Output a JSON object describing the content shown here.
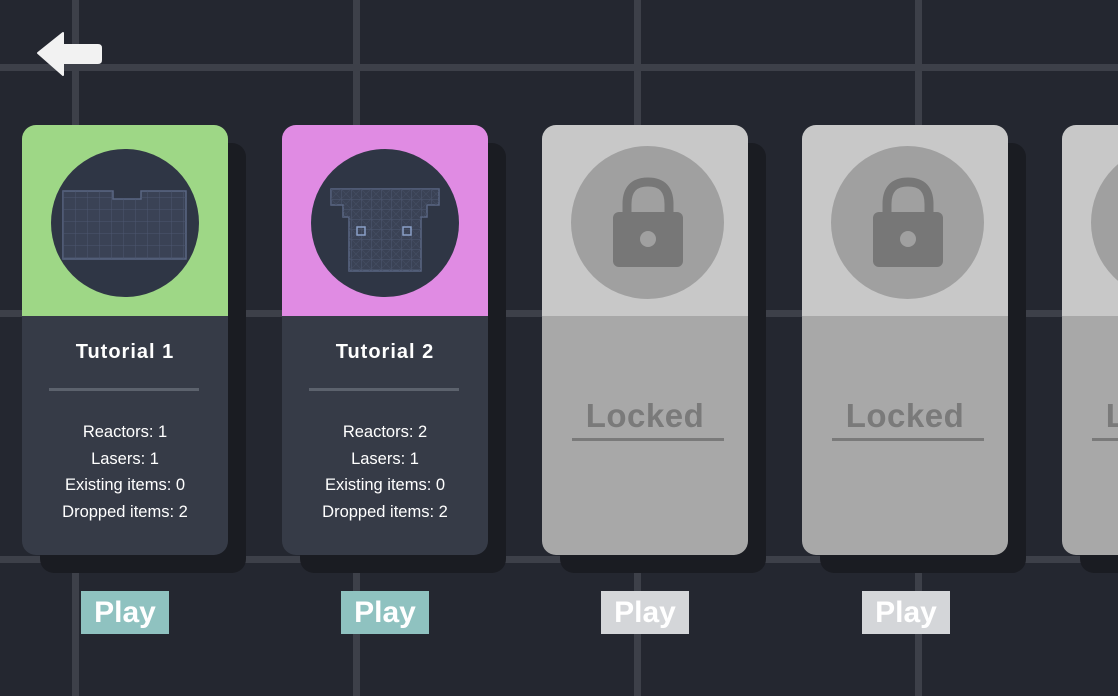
{
  "levels": [
    {
      "title": "Tutorial 1",
      "stats": {
        "reactors": "Reactors: 1",
        "lasers": "Lasers: 1",
        "existing": "Existing items: 0",
        "dropped": "Dropped items: 2"
      },
      "play_label": "Play",
      "accent_color": "#9ed786",
      "locked": false
    },
    {
      "title": "Tutorial 2",
      "stats": {
        "reactors": "Reactors: 2",
        "lasers": "Lasers: 1",
        "existing": "Existing items: 0",
        "dropped": "Dropped items: 2"
      },
      "play_label": "Play",
      "accent_color": "#e08be3",
      "locked": false
    },
    {
      "locked_label": "Locked",
      "play_label": "Play",
      "locked": true
    },
    {
      "locked_label": "Locked",
      "play_label": "Play",
      "locked": true
    },
    {
      "locked_label": "Locked",
      "locked": true
    }
  ],
  "colors": {
    "background": "#242730",
    "grid_line": "#3d4049",
    "card_dark": "#363b47",
    "locked_light": "#c8c8c8",
    "locked_mid": "#a8a8a8",
    "play_active": "#8fc2c0",
    "play_disabled": "#d4d6d9"
  },
  "icons": {
    "back": "arrow-left-icon",
    "lock": "padlock-icon"
  }
}
